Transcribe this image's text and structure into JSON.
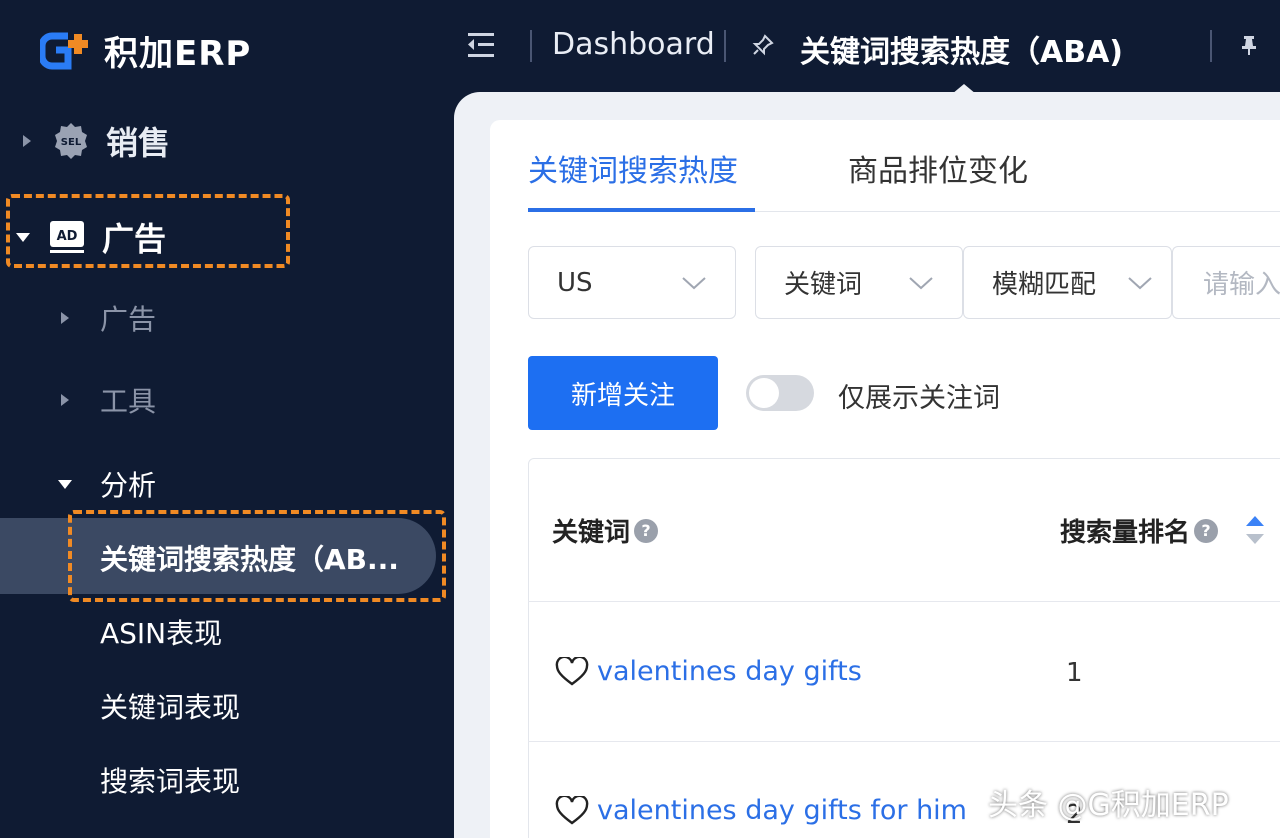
{
  "app": {
    "logo_text": "积加ERP"
  },
  "breadcrumb": {
    "home": "Dashboard",
    "current": "关键词搜索热度（ABA)"
  },
  "sidebar": {
    "groups": [
      {
        "label": "销售"
      },
      {
        "label": "广告"
      }
    ],
    "sub": [
      {
        "label": "广告"
      },
      {
        "label": "工具"
      },
      {
        "label": "分析"
      }
    ],
    "leaves": [
      {
        "label": "关键词搜索热度（AB..."
      },
      {
        "label": "ASIN表现"
      },
      {
        "label": "关键词表现"
      },
      {
        "label": "搜索词表现"
      }
    ]
  },
  "tabs": [
    {
      "label": "关键词搜索热度"
    },
    {
      "label": "商品排位变化"
    }
  ],
  "filters": {
    "market": "US",
    "field": "关键词",
    "match": "模糊匹配",
    "input_placeholder": "请输入"
  },
  "actions": {
    "add_follow": "新增关注",
    "only_followed": "仅展示关注词",
    "only_followed_on": false
  },
  "table": {
    "columns": [
      "关键词",
      "搜索量排名"
    ],
    "rows": [
      {
        "keyword": "valentines day gifts",
        "rank": "1"
      },
      {
        "keyword": "valentines day gifts for him",
        "rank": "2"
      }
    ]
  },
  "watermark": "头条 @G积加ERP",
  "colors": {
    "sidebar_bg": "#0f1b33",
    "primary": "#1d6ff2",
    "highlight": "#f08a24"
  }
}
